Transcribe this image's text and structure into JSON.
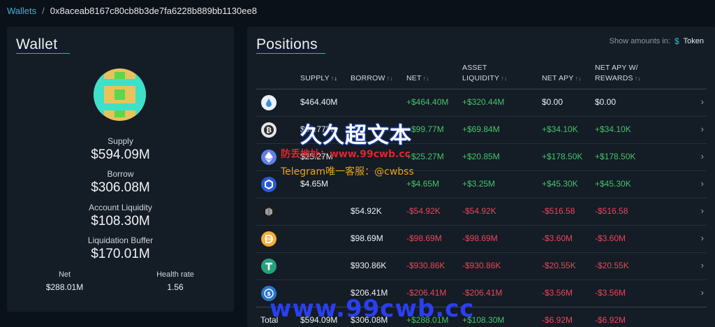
{
  "breadcrumb": {
    "root": "Wallets",
    "separator": "/",
    "address": "0x8aceab8167c80cb8b3de7fa6228b889bb1130ee8"
  },
  "wallet": {
    "title": "Wallet",
    "supply_label": "Supply",
    "supply_value": "$594.09M",
    "borrow_label": "Borrow",
    "borrow_value": "$306.08M",
    "liquidity_label": "Account Liquidity",
    "liquidity_value": "$108.30M",
    "buffer_label": "Liquidation Buffer",
    "buffer_value": "$170.01M",
    "net_label": "Net",
    "net_value": "$288.01M",
    "health_label": "Health rate",
    "health_value": "1.56"
  },
  "positions": {
    "title": "Positions",
    "amounts_label": "Show amounts in:",
    "amounts_currency": "$",
    "amounts_unit": "Token",
    "headers": {
      "supply": "SUPPLY",
      "borrow": "BORROW",
      "net": "NET",
      "asset_liquidity_1": "ASSET",
      "asset_liquidity_2": "LIQUIDITY",
      "net_apy": "NET APY",
      "net_apy_rewards_1": "NET APY W/",
      "net_apy_rewards_2": "REWARDS"
    },
    "rows": [
      {
        "icon": "eth-staked-icon",
        "supply": "$464.40M",
        "borrow": "",
        "net": "+$464.40M",
        "liquidity": "+$320.44M",
        "apy": "$0.00",
        "apy_rewards": "$0.00"
      },
      {
        "icon": "bitcoin-icon",
        "supply": "$99.77M",
        "borrow": "",
        "net": "+$99.77M",
        "liquidity": "+$69.84M",
        "apy": "+$34.10K",
        "apy_rewards": "+$34.10K"
      },
      {
        "icon": "ethereum-icon",
        "supply": "$25.27M",
        "borrow": "",
        "net": "+$25.27M",
        "liquidity": "+$20.85M",
        "apy": "+$178.50K",
        "apy_rewards": "+$178.50K"
      },
      {
        "icon": "chainlink-icon",
        "supply": "$4.65M",
        "borrow": "",
        "net": "+$4.65M",
        "liquidity": "+$3.25M",
        "apy": "+$45.30K",
        "apy_rewards": "+$45.30K"
      },
      {
        "icon": "cube-token-icon",
        "supply": "",
        "borrow": "$54.92K",
        "net": "-$54.92K",
        "liquidity": "-$54.92K",
        "apy": "-$516.58",
        "apy_rewards": "-$516.58"
      },
      {
        "icon": "dai-icon",
        "supply": "",
        "borrow": "$98.69M",
        "net": "-$98.69M",
        "liquidity": "-$98.69M",
        "apy": "-$3.60M",
        "apy_rewards": "-$3.60M"
      },
      {
        "icon": "tether-icon",
        "supply": "",
        "borrow": "$930.86K",
        "net": "-$930.86K",
        "liquidity": "-$930.86K",
        "apy": "-$20.55K",
        "apy_rewards": "-$20.55K"
      },
      {
        "icon": "usdc-icon",
        "supply": "",
        "borrow": "$206.41M",
        "net": "-$206.41M",
        "liquidity": "-$206.41M",
        "apy": "-$3.56M",
        "apy_rewards": "-$3.56M"
      }
    ],
    "total": {
      "label": "Total",
      "supply": "$594.09M",
      "borrow": "$306.08M",
      "net": "+$288.01M",
      "liquidity": "+$108.30M",
      "apy": "-$6.92M",
      "apy_rewards": "-$6.92M"
    }
  },
  "watermark": {
    "big": "久久超文本",
    "line1": "防丢地址：www.99cwb.cc",
    "line2": "Telegram唯一客服：@cwbss",
    "bottom": "www.99cwb.cc"
  },
  "colors": {
    "accent": "#3fb4d6",
    "positive": "#44c46b",
    "negative": "#e9465a",
    "panel": "#141c25",
    "background": "#0b1118"
  }
}
